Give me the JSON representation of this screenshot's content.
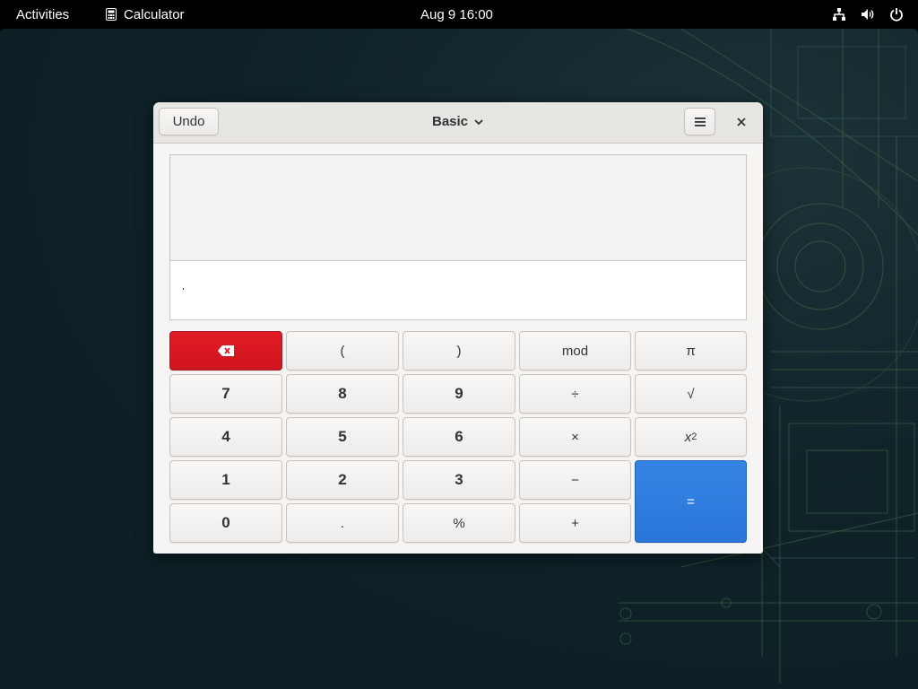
{
  "topbar": {
    "activities": "Activities",
    "app_name": "Calculator",
    "clock": "Aug 9  16:00",
    "icons": [
      "calculator-icon",
      "network-icon",
      "volume-icon",
      "power-icon"
    ]
  },
  "window": {
    "undo_label": "Undo",
    "mode_label": "Basic",
    "icons": [
      "chevron-down-icon",
      "hamburger-menu-icon",
      "close-icon"
    ]
  },
  "display": {
    "history_text": "",
    "entry_value": ""
  },
  "keypad": {
    "row1": {
      "backspace_icon": "backspace-icon",
      "lparen": "(",
      "rparen": ")",
      "mod": "mod",
      "pi": "π"
    },
    "row2": {
      "k7": "7",
      "k8": "8",
      "k9": "9",
      "divide": "÷",
      "sqrt": "√"
    },
    "row3": {
      "k4": "4",
      "k5": "5",
      "k6": "6",
      "multiply": "×",
      "square_base": "x",
      "square_exp": "2"
    },
    "row4": {
      "k1": "1",
      "k2": "2",
      "k3": "3",
      "subtract": "−",
      "equals": "="
    },
    "row5": {
      "k0": "0",
      "point": ".",
      "percent": "%",
      "add": "+"
    }
  },
  "colors": {
    "danger": "#e01b24",
    "accent": "#3584e4"
  }
}
